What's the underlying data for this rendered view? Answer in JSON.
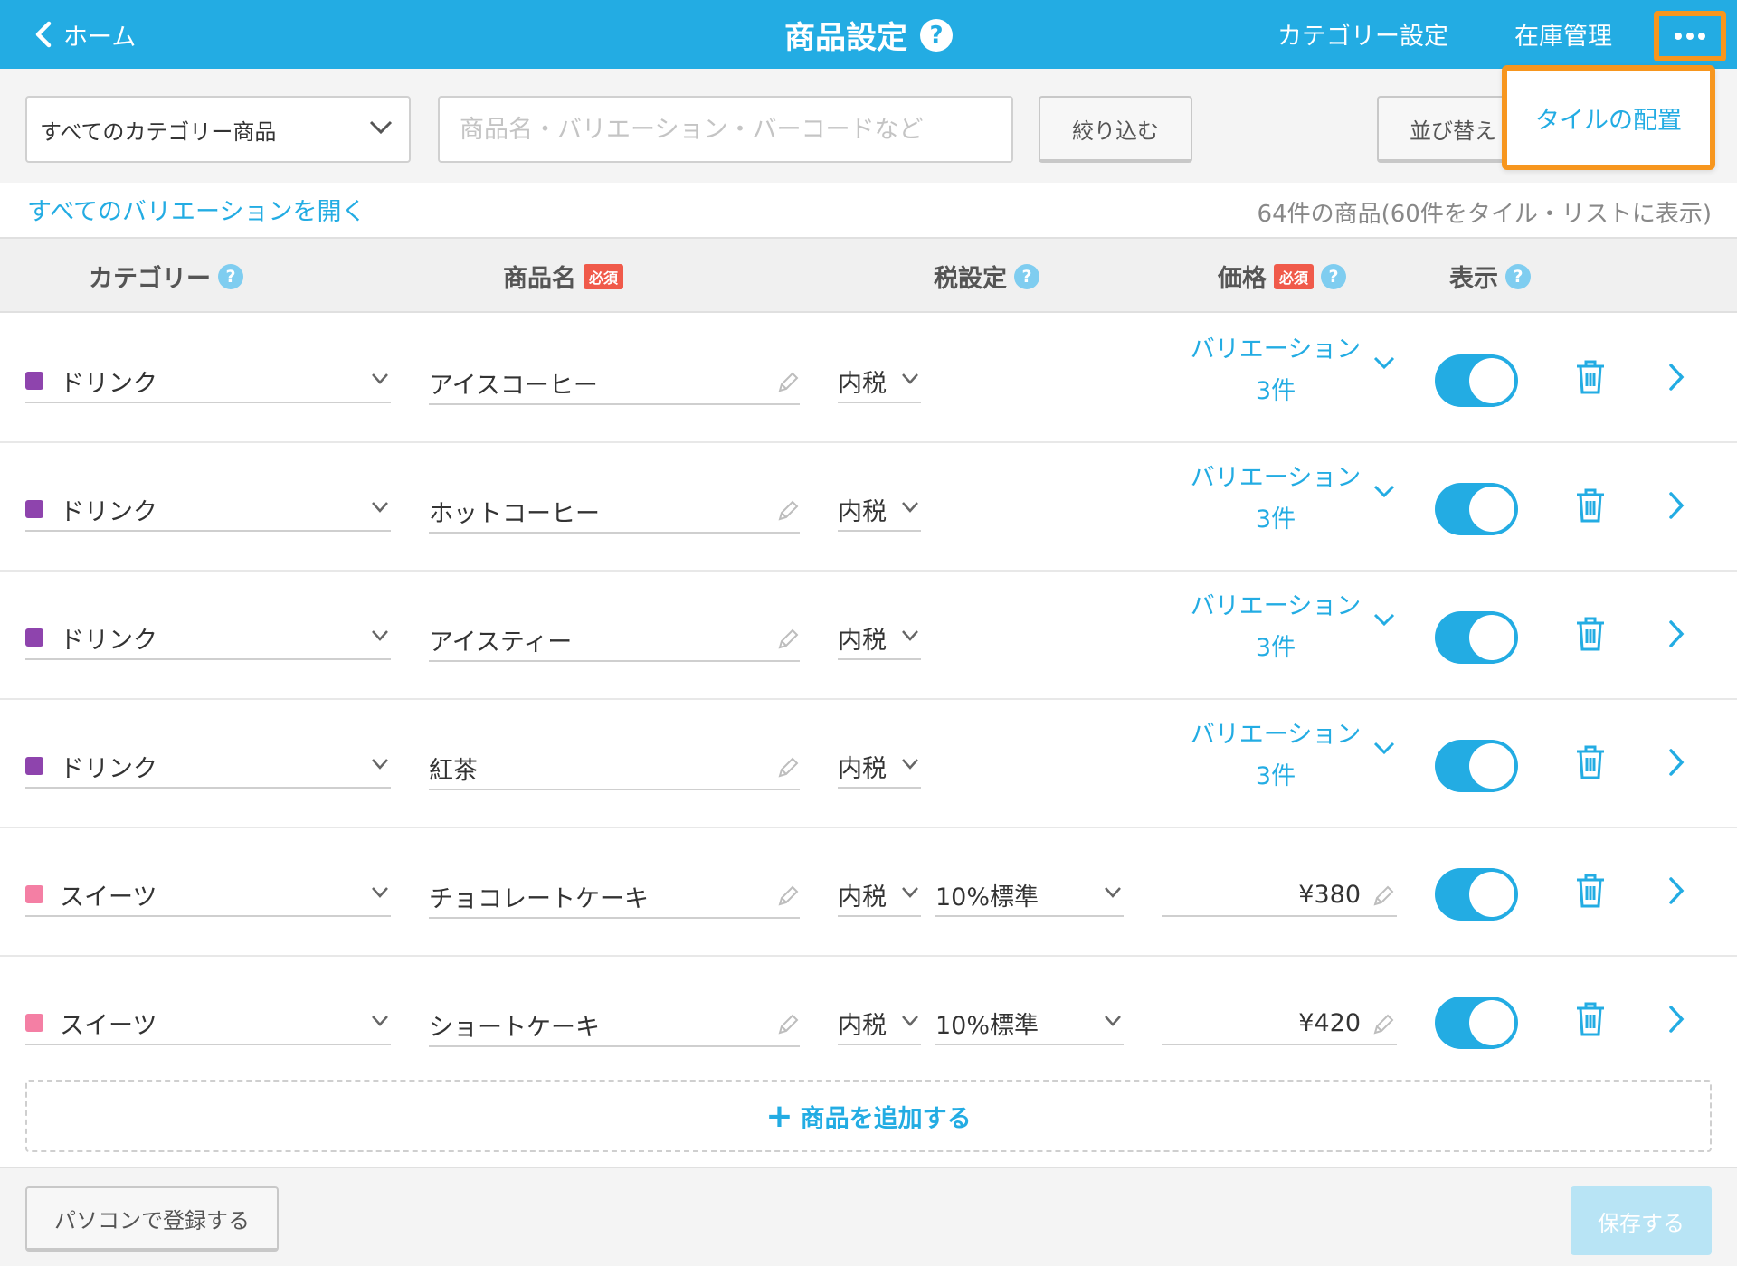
{
  "header": {
    "back_label": "ホーム",
    "title": "商品設定",
    "help": "?",
    "nav_category": "カテゴリー設定",
    "nav_inventory": "在庫管理",
    "more_icon": "ellipsis-icon"
  },
  "toolbar": {
    "category_select": "すべてのカテゴリー商品",
    "search_placeholder": "商品名・バリエーション・バーコードなど",
    "filter_label": "絞り込む",
    "sort_label": "並び替え"
  },
  "menu": {
    "tile_layout": "タイルの配置"
  },
  "info": {
    "expand_all": "すべてのバリエーションを開く",
    "count": "64件の商品(60件をタイル・リストに表示)"
  },
  "columns": {
    "category": "カテゴリー",
    "name": "商品名",
    "tax": "税設定",
    "price": "価格",
    "display": "表示",
    "required": "必須",
    "help": "?"
  },
  "colors": {
    "accent": "#23ace3",
    "highlight": "#f7961e",
    "drink": "#8e44ad",
    "sweets": "#f47fa4",
    "required": "#f05a4a"
  },
  "rows": [
    {
      "category": "ドリンク",
      "name": "アイスコーヒー",
      "tax": "内税",
      "rate": "",
      "variation": "バリエーション",
      "variation_count": "3件",
      "price": ""
    },
    {
      "category": "ドリンク",
      "name": "ホットコーヒー",
      "tax": "内税",
      "rate": "",
      "variation": "バリエーション",
      "variation_count": "3件",
      "price": ""
    },
    {
      "category": "ドリンク",
      "name": "アイスティー",
      "tax": "内税",
      "rate": "",
      "variation": "バリエーション",
      "variation_count": "3件",
      "price": ""
    },
    {
      "category": "ドリンク",
      "name": "紅茶",
      "tax": "内税",
      "rate": "",
      "variation": "バリエーション",
      "variation_count": "3件",
      "price": ""
    },
    {
      "category": "スイーツ",
      "name": "チョコレートケーキ",
      "tax": "内税",
      "rate": "10%標準",
      "variation": "",
      "variation_count": "",
      "price": "¥380"
    },
    {
      "category": "スイーツ",
      "name": "ショートケーキ",
      "tax": "内税",
      "rate": "10%標準",
      "variation": "",
      "variation_count": "",
      "price": "¥420"
    }
  ],
  "add_product": "商品を追加する",
  "footer": {
    "pc_register": "パソコンで登録する",
    "save": "保存する"
  }
}
